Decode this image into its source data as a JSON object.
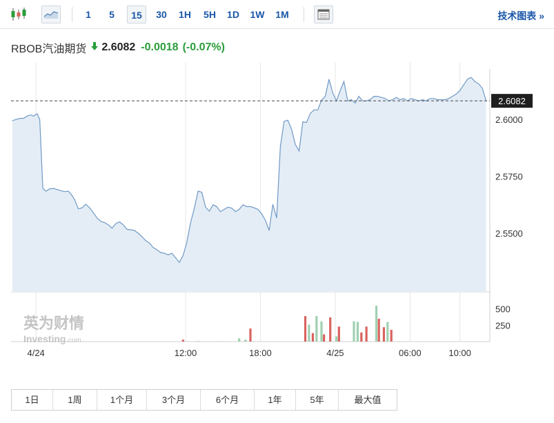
{
  "toolbar": {
    "intervals": [
      "1",
      "5",
      "15",
      "30",
      "1H",
      "5H",
      "1D",
      "1W",
      "1M"
    ],
    "active_interval": "15",
    "tech_chart_label": "技术图表 »",
    "icons": [
      "candlestick-icon",
      "area-chart-icon",
      "table-icon"
    ]
  },
  "quote": {
    "name": "RBOB汽油期货",
    "price": "2.6082",
    "change": "-0.0018",
    "change_pct": "(-0.07%)",
    "direction": "down",
    "change_color": "#2a9d3a",
    "arrow_color": "#2a9d3a"
  },
  "watermark": {
    "cn": "英为财情",
    "en": "Investing",
    "suffix": ".com"
  },
  "ranges": [
    "1日",
    "1周",
    "1个月",
    "3个月",
    "6个月",
    "1年",
    "5年",
    "最大值"
  ],
  "colors": {
    "line": "#6f98c4",
    "area": "#e4edf6",
    "vol_up": "#9fd0b1",
    "vol_down": "#d9635f",
    "link": "#1a56a8"
  },
  "chart_data": {
    "type": "area",
    "price_label": "2.6082",
    "y_ticks": [
      "2.6000",
      "2.5750",
      "2.5500"
    ],
    "y_tick_values": [
      2.6,
      2.575,
      2.55
    ],
    "ylim": [
      2.5242,
      2.6222
    ],
    "x_ticks": [
      "4/24",
      "12:00",
      "18:00",
      "4/25",
      "06:00",
      "10:00"
    ],
    "x_tick_hours": [
      0,
      12,
      18,
      24,
      30,
      34
    ],
    "x_range_hours": [
      -2.0,
      36.4
    ],
    "price": {
      "x": [
        -1.9,
        -1.6,
        -1.3,
        -1.0,
        -0.7,
        -0.45,
        -0.2,
        0.1,
        0.3,
        0.55,
        0.8,
        1.1,
        1.4,
        1.7,
        2.0,
        2.3,
        2.6,
        2.9,
        3.1,
        3.4,
        3.7,
        4.0,
        4.3,
        4.6,
        4.9,
        5.2,
        5.5,
        5.8,
        6.1,
        6.4,
        6.7,
        7.0,
        7.3,
        7.6,
        7.9,
        8.2,
        8.5,
        8.8,
        9.1,
        9.4,
        9.7,
        10.0,
        10.3,
        10.6,
        10.9,
        11.2,
        11.5,
        11.8,
        12.1,
        12.4,
        12.7,
        13.0,
        13.3,
        13.6,
        13.9,
        14.2,
        14.5,
        14.8,
        15.1,
        15.4,
        15.7,
        16.0,
        16.3,
        16.6,
        16.9,
        17.2,
        17.5,
        17.8,
        18.1,
        18.4,
        18.7,
        19.0,
        19.3,
        19.6,
        19.9,
        20.2,
        20.5,
        20.8,
        21.1,
        21.4,
        21.7,
        22.0,
        22.3,
        22.6,
        22.9,
        23.2,
        23.5,
        23.8,
        24.1,
        24.4,
        24.7,
        25.0,
        25.3,
        25.6,
        25.9,
        26.2,
        26.5,
        26.8,
        27.1,
        27.4,
        27.7,
        28.0,
        28.3,
        28.6,
        28.9,
        29.2,
        29.5,
        29.8,
        30.1,
        30.4,
        30.7,
        31.0,
        31.3,
        31.6,
        31.9,
        32.2,
        32.5,
        32.8,
        33.1,
        33.4,
        33.7,
        34.0,
        34.3,
        34.6,
        34.9,
        35.2,
        35.5,
        35.8,
        36.1
      ],
      "y": [
        2.5995,
        2.6,
        2.6005,
        2.6005,
        2.6015,
        2.602,
        2.6015,
        2.6025,
        2.6,
        2.5697,
        2.5685,
        2.5695,
        2.5697,
        2.5692,
        2.5687,
        2.5683,
        2.5685,
        2.5665,
        2.5647,
        2.5607,
        2.5612,
        2.5627,
        2.5612,
        2.559,
        2.5567,
        2.5552,
        2.5547,
        2.5537,
        2.5522,
        2.5542,
        2.555,
        2.5537,
        2.5517,
        2.5515,
        2.5512,
        2.55,
        2.5485,
        2.5467,
        2.5457,
        2.5437,
        2.5427,
        2.5415,
        2.5412,
        2.5405,
        2.5412,
        2.5392,
        2.5372,
        2.5402,
        2.546,
        2.5547,
        2.561,
        2.5685,
        2.568,
        2.5615,
        2.5597,
        2.5625,
        2.5617,
        2.5595,
        2.5605,
        2.5615,
        2.561,
        2.5595,
        2.5605,
        2.5625,
        2.5617,
        2.5617,
        2.5612,
        2.5605,
        2.5585,
        2.5557,
        2.5512,
        2.5627,
        2.5567,
        2.5882,
        2.5992,
        2.5997,
        2.5957,
        2.589,
        2.5862,
        2.599,
        2.5987,
        2.6027,
        2.6042,
        2.6042,
        2.6085,
        2.6102,
        2.6177,
        2.6117,
        2.6082,
        2.6127,
        2.6167,
        2.6082,
        2.6087,
        2.6072,
        2.6102,
        2.6082,
        2.6082,
        2.6087,
        2.6102,
        2.6102,
        2.6097,
        2.6092,
        2.6082,
        2.6087,
        2.6097,
        2.6087,
        2.6092,
        2.6082,
        2.6092,
        2.6087,
        2.6082,
        2.6087,
        2.6082,
        2.6092,
        2.6092,
        2.6087,
        2.6087,
        2.6087,
        2.6092,
        2.6102,
        2.6112,
        2.6127,
        2.6152,
        2.6177,
        2.6185,
        2.6167,
        2.6157,
        2.6137,
        2.6082
      ]
    },
    "volume_ticks": [
      "500",
      "250"
    ],
    "volume_tick_values": [
      500,
      250
    ],
    "volume_max": 730,
    "volume": [
      {
        "x": 11.8,
        "v": 30,
        "dir": "down"
      },
      {
        "x": 13.0,
        "v": 8,
        "dir": "up"
      },
      {
        "x": 14.9,
        "v": 5,
        "dir": "up"
      },
      {
        "x": 16.3,
        "v": 50,
        "dir": "up"
      },
      {
        "x": 16.8,
        "v": 30,
        "dir": "up"
      },
      {
        "x": 17.2,
        "v": 200,
        "dir": "down"
      },
      {
        "x": 21.6,
        "v": 390,
        "dir": "down"
      },
      {
        "x": 21.9,
        "v": 260,
        "dir": "up"
      },
      {
        "x": 22.2,
        "v": 130,
        "dir": "down"
      },
      {
        "x": 22.5,
        "v": 390,
        "dir": "up"
      },
      {
        "x": 22.9,
        "v": 310,
        "dir": "up"
      },
      {
        "x": 23.1,
        "v": 110,
        "dir": "down"
      },
      {
        "x": 23.6,
        "v": 370,
        "dir": "down"
      },
      {
        "x": 24.1,
        "v": 80,
        "dir": "up"
      },
      {
        "x": 24.3,
        "v": 230,
        "dir": "down"
      },
      {
        "x": 25.5,
        "v": 310,
        "dir": "up"
      },
      {
        "x": 25.8,
        "v": 300,
        "dir": "up"
      },
      {
        "x": 26.1,
        "v": 140,
        "dir": "down"
      },
      {
        "x": 26.5,
        "v": 230,
        "dir": "down"
      },
      {
        "x": 27.3,
        "v": 550,
        "dir": "up"
      },
      {
        "x": 27.5,
        "v": 350,
        "dir": "down"
      },
      {
        "x": 27.9,
        "v": 220,
        "dir": "down"
      },
      {
        "x": 28.2,
        "v": 300,
        "dir": "up"
      },
      {
        "x": 28.5,
        "v": 180,
        "dir": "down"
      }
    ]
  }
}
